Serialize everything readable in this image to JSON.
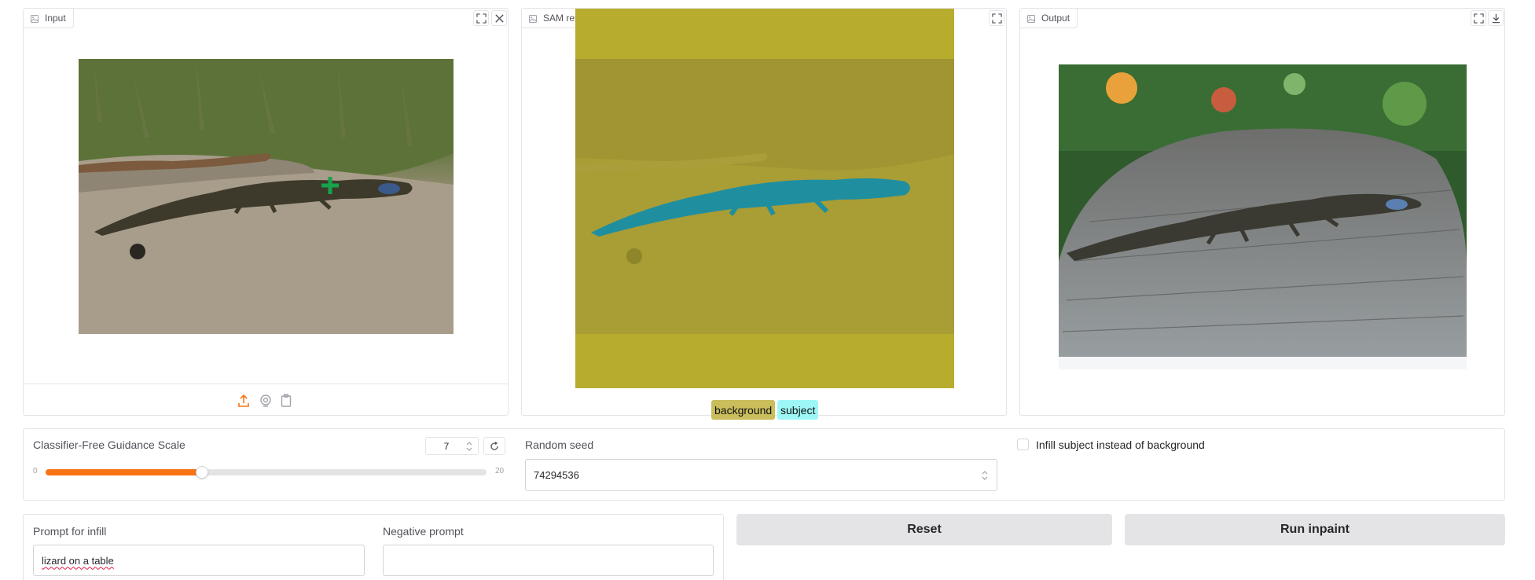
{
  "input_panel": {
    "label": "Input"
  },
  "sam_panel": {
    "label": "SAM result",
    "legend": [
      "background",
      "subject"
    ]
  },
  "output_panel": {
    "label": "Output"
  },
  "guidance": {
    "label": "Classifier-Free Guidance Scale",
    "value": "7",
    "min": "0",
    "max": "20",
    "fraction": 0.35
  },
  "seed": {
    "label": "Random seed",
    "value": "74294536"
  },
  "infill_checkbox": {
    "label": "Infill subject instead of background",
    "checked": false
  },
  "prompt": {
    "label": "Prompt for infill",
    "value": "lizard on a table"
  },
  "negative_prompt": {
    "label": "Negative prompt",
    "value": ""
  },
  "buttons": {
    "reset": "Reset",
    "run": "Run inpaint"
  },
  "colors": {
    "accent": "#f97316",
    "mask_background": "#b8ac2e",
    "mask_subject": "#1f8fa0",
    "chip_background": "#c9bd5c",
    "chip_subject": "#9ef7f7"
  }
}
